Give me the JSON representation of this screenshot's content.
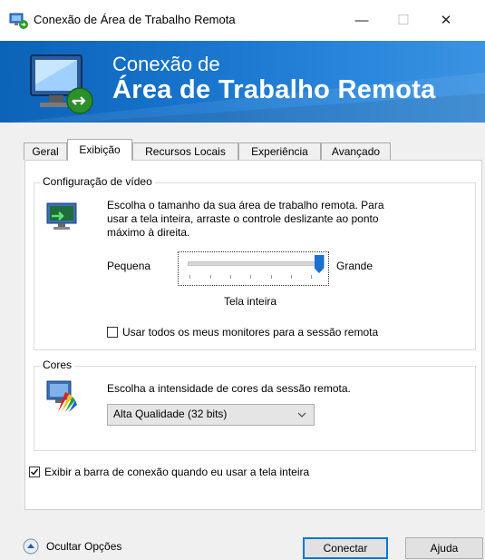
{
  "window": {
    "title": "Conexão de Área de Trabalho Remota",
    "controls": {
      "minimize": "—",
      "maximize": "☐",
      "close": "✕"
    }
  },
  "banner": {
    "line1": "Conexão de",
    "line2": "Área de Trabalho Remota"
  },
  "tabs": [
    {
      "label": "Geral",
      "active": false
    },
    {
      "label": "Exibição",
      "active": true
    },
    {
      "label": "Recursos Locais",
      "active": false
    },
    {
      "label": "Experiência",
      "active": false
    },
    {
      "label": "Avançado",
      "active": false
    }
  ],
  "display": {
    "group_label": "Configuração de vídeo",
    "description": [
      "Escolha o tamanho da sua área de trabalho remota. Para",
      "usar a tela inteira, arraste o controle deslizante ao ponto",
      "máximo à direita."
    ],
    "slider": {
      "min_label": "Pequena",
      "max_label": "Grande",
      "value_label": "Tela inteira",
      "position_fraction": 1.0
    },
    "all_monitors": {
      "label": "Usar todos os meus monitores para a sessão remota",
      "checked": false
    }
  },
  "colors": {
    "group_label": "Cores",
    "description": "Escolha a intensidade de cores da sessão remota.",
    "selected": "Alta Qualidade (32 bits)"
  },
  "connection_bar": {
    "label": "Exibir a barra de conexão quando eu usar a tela inteira",
    "checked": true
  },
  "footer": {
    "hide_options": "Ocultar Opções",
    "connect": "Conectar",
    "help": "Ajuda"
  },
  "accent_color": "#0c63b8"
}
